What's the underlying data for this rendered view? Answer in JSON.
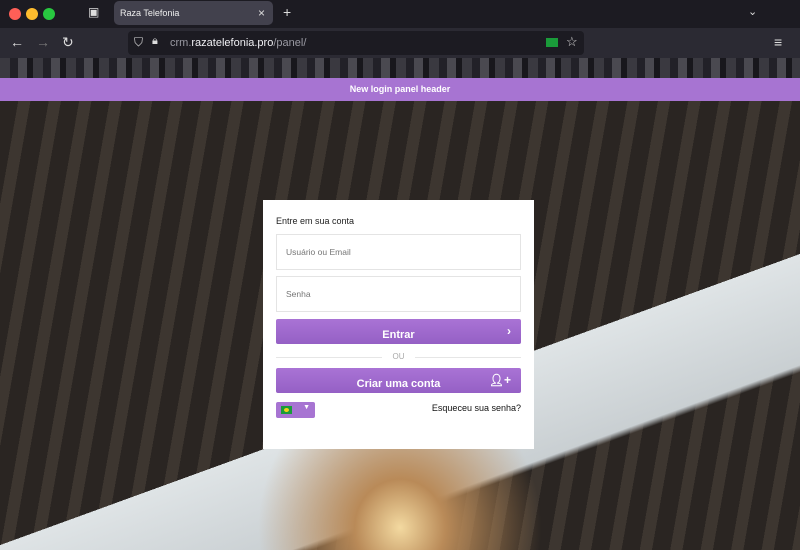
{
  "browser": {
    "tab_title": "Raza Telefonia",
    "url_prefix": "crm.",
    "url_domain": "razatelefonia.pro",
    "url_path": "/panel/",
    "close": "×",
    "new_tab": "+"
  },
  "banner": "New login panel header",
  "login": {
    "title": "Entre em sua conta",
    "username_placeholder": "Usuário ou Email",
    "password_placeholder": "Senha",
    "submit": "Entrar",
    "or": "OU",
    "register": "Criar uma conta",
    "forgot": "Esqueceu sua senha?"
  }
}
